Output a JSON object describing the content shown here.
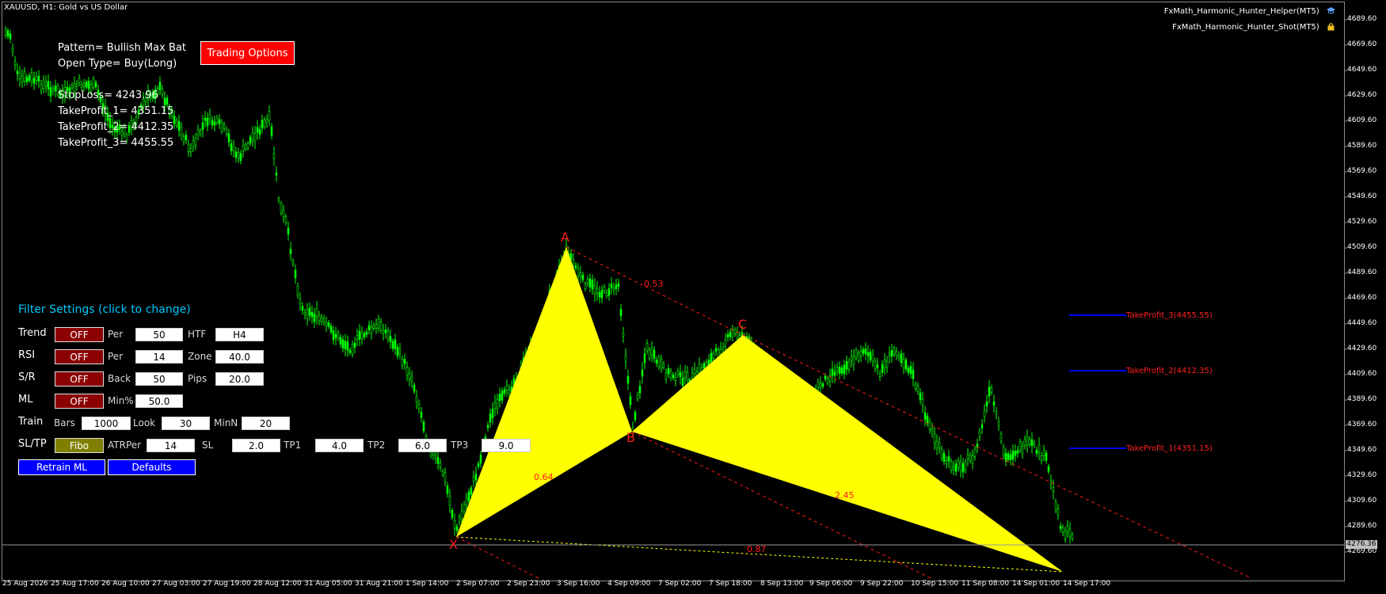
{
  "header": {
    "symbol": "XAUUSD, H1:  Gold vs US Dollar"
  },
  "indicators": [
    {
      "label": "FxMath_Harmonic_Hunter_Helper(MT5)",
      "icon": "graduation-cap-icon"
    },
    {
      "label": "FxMath_Harmonic_Hunter_Shot(MT5)",
      "icon": "lock-icon"
    }
  ],
  "info": {
    "pattern": "Pattern= Bullish Max Bat",
    "open_type": "Open Type= Buy(Long)",
    "stop_loss": "StopLoss= 4243.96",
    "tp1": "TakeProfit_1= 4351.15",
    "tp2": "TakeProfit_2= 4412.35",
    "tp3": "TakeProfit_3= 4455.55"
  },
  "trading_options_label": "Trading Options",
  "filter": {
    "title": "Filter Settings  (click to change)",
    "trend": {
      "label": "Trend",
      "toggle": "OFF",
      "per_label": "Per",
      "per": "50",
      "htf_label": "HTF",
      "htf": "H4"
    },
    "rsi": {
      "label": "RSI",
      "toggle": "OFF",
      "per_label": "Per",
      "per": "14",
      "zone_label": "Zone",
      "zone": "40.0"
    },
    "sr": {
      "label": "S/R",
      "toggle": "OFF",
      "back_label": "Back",
      "back": "50",
      "pips_label": "Pips",
      "pips": "20.0"
    },
    "ml": {
      "label": "ML",
      "toggle": "OFF",
      "min_label": "Min%",
      "min": "50.0"
    },
    "train": {
      "label": "Train",
      "bars_label": "Bars",
      "bars": "1000",
      "look_label": "Look",
      "look": "30",
      "minn_label": "MinN",
      "minn": "20"
    },
    "sltp": {
      "label": "SL/TP",
      "mode": "Fibo",
      "atr_label": "ATRPer",
      "atr": "14",
      "sl_label": "SL",
      "sl": "2.0",
      "tp1_label": "TP1",
      "tp1": "4.0",
      "tp2_label": "TP2",
      "tp2": "6.0",
      "tp3_label": "TP3",
      "tp3": "9.0"
    },
    "retrain_label": "Retrain ML",
    "defaults_label": "Defaults"
  },
  "price_axis": [
    "4689.60",
    "4669.60",
    "4649.60",
    "4629.60",
    "4609.60",
    "4589.60",
    "4569.60",
    "4549.60",
    "4529.60",
    "4509.60",
    "4489.60",
    "4469.60",
    "4449.60",
    "4429.60",
    "4409.60",
    "4389.60",
    "4369.60",
    "4349.60",
    "4329.60",
    "4309.60",
    "4289.60",
    "4269.60"
  ],
  "current_price": "4276.36",
  "time_axis": [
    "25 Aug 2026",
    "25 Aug 17:00",
    "26 Aug 10:00",
    "27 Aug 03:00",
    "27 Aug 19:00",
    "28 Aug 12:00",
    "31 Aug 05:00",
    "31 Aug 21:00",
    "1 Sep 14:00",
    "2 Sep 07:00",
    "2 Sep 23:00",
    "3 Sep 16:00",
    "4 Sep 09:00",
    "7 Sep 02:00",
    "7 Sep 18:00",
    "8 Sep 13:00",
    "9 Sep 06:00",
    "9 Sep 22:00",
    "10 Sep 15:00",
    "11 Sep 08:00",
    "14 Sep 01:00",
    "14 Sep 17:00"
  ],
  "pattern": {
    "points": {
      "x": "X",
      "a": "A",
      "b": "B",
      "c": "C"
    },
    "ratios": {
      "ab": "0.53",
      "xb": "0.64",
      "bd": "2.45",
      "xd": "0.87"
    }
  },
  "tp_lines": {
    "tp3": "TakeProfit_3(4455.55)",
    "tp2": "TakeProfit_2(4412.35)",
    "tp1": "TakeProfit_1(4351.15)"
  },
  "colors": {
    "candle": "#00ff00",
    "pattern_fill": "#ffff00",
    "accent_red": "#ff0000",
    "tp_line": "#0000ff",
    "filter_title": "#00c8ff"
  }
}
